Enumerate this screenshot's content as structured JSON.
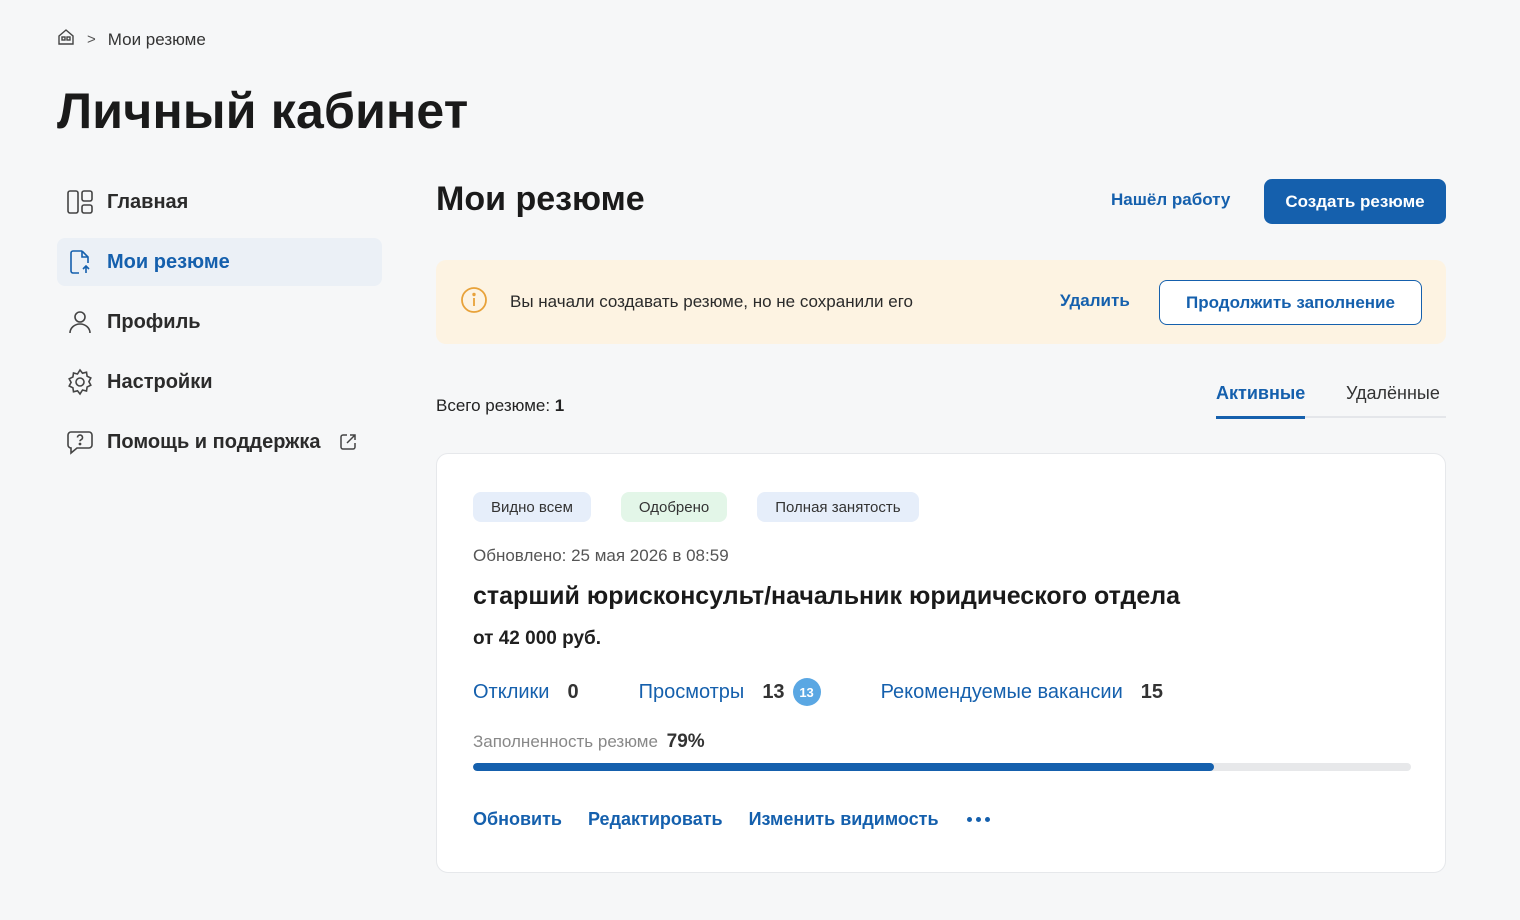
{
  "breadcrumb": {
    "separator": ">",
    "current": "Мои резюме"
  },
  "page": {
    "title": "Личный кабинет"
  },
  "sidebar": {
    "items": [
      {
        "label": "Главная",
        "icon": "dashboard-icon"
      },
      {
        "label": "Мои резюме",
        "icon": "document-upload-icon",
        "active": true
      },
      {
        "label": "Профиль",
        "icon": "user-icon"
      },
      {
        "label": "Настройки",
        "icon": "gear-icon"
      },
      {
        "label": "Помощь и поддержка",
        "icon": "help-chat-icon",
        "external": true
      }
    ]
  },
  "header": {
    "title": "Мои резюме",
    "found_job_label": "Нашёл работу",
    "create_label": "Создать резюме"
  },
  "notice": {
    "text": "Вы начали создавать резюме, но не сохранили его",
    "delete_label": "Удалить",
    "continue_label": "Продолжить заполнение",
    "icon": "info-icon"
  },
  "summary": {
    "total_label": "Всего резюме:",
    "total_value": "1"
  },
  "tabs": {
    "active": "Активные",
    "deleted": "Удалённые"
  },
  "resume": {
    "badges": [
      "Видно всем",
      "Одобрено",
      "Полная занятость"
    ],
    "updated": "Обновлено: 25 мая 2026 в 08:59",
    "title": "старший юрисконсульт/начальник юридического отдела",
    "salary": "от 42 000 руб.",
    "stats": {
      "responses_label": "Отклики",
      "responses_value": "0",
      "views_label": "Просмотры",
      "views_value": "13",
      "views_new": "13",
      "recommended_label": "Рекомендуемые вакансии",
      "recommended_value": "15"
    },
    "completeness_label": "Заполненность резюме",
    "completeness_value": "79%",
    "completeness_fraction": 0.79,
    "actions": {
      "update": "Обновить",
      "edit": "Редактировать",
      "visibility": "Изменить видимость"
    }
  },
  "colors": {
    "accent": "#1560ad",
    "notice_bg": "#fdf3e2",
    "badge_blue": "#e6eefa",
    "badge_green": "#e3f6e8",
    "bubble": "#5aa7e3",
    "warning": "#e8a23a"
  }
}
